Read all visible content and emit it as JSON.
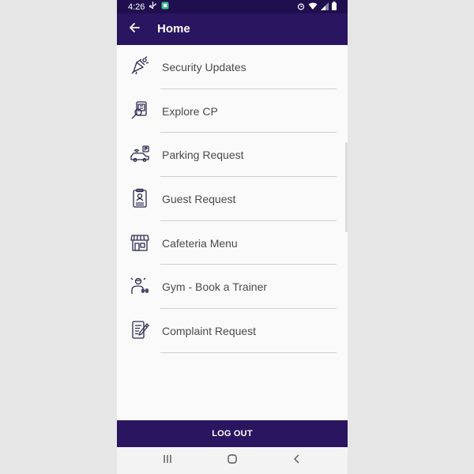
{
  "status_bar": {
    "time": "4:26",
    "left_icons": [
      "usb-icon",
      "app-notification-icon"
    ],
    "right_icons": [
      "alarm-icon",
      "wifi-icon",
      "signal-icon",
      "battery-icon"
    ]
  },
  "app_bar": {
    "title": "Home",
    "back_icon": "arrow-left-icon"
  },
  "menu": {
    "items": [
      {
        "label": "Security Updates",
        "icon": "security-alarm-icon"
      },
      {
        "label": "Explore CP",
        "icon": "explore-map-icon"
      },
      {
        "label": "Parking Request",
        "icon": "parking-car-icon"
      },
      {
        "label": "Guest Request",
        "icon": "guest-clipboard-icon"
      },
      {
        "label": "Cafeteria Menu",
        "icon": "cafeteria-store-icon"
      },
      {
        "label": "Gym - Book a Trainer",
        "icon": "gym-trainer-icon"
      },
      {
        "label": "Complaint Request",
        "icon": "complaint-form-icon"
      }
    ]
  },
  "logout": {
    "label": "LOG OUT"
  },
  "nav": {
    "icons": [
      "recent-apps-icon",
      "home-icon",
      "back-icon"
    ]
  },
  "colors": {
    "primary": "#2a1560",
    "status_bar": "#1f0f4e",
    "background": "#fafafa",
    "page_background": "#e6e6e6",
    "icon_stroke": "#2c2a4f",
    "label_text": "#4a4a4a",
    "divider": "#cfcfcf"
  }
}
